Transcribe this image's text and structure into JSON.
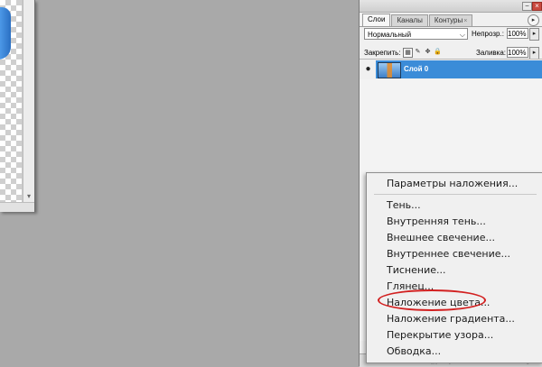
{
  "document": {
    "scroll_arrow": "▾"
  },
  "panel": {
    "tabs": [
      {
        "label": "Слои",
        "active": true
      },
      {
        "label": "Каналы",
        "active": false
      },
      {
        "label": "Контуры",
        "active": false
      }
    ],
    "tab_close_glyph": "×",
    "menu_glyph": "▸",
    "blend_mode": "Нормальный",
    "opacity_label": "Непрозр.:",
    "opacity_value": "100%",
    "lock_label": "Закрепить:",
    "fill_label": "Заливка:",
    "fill_value": "100%",
    "layers": [
      {
        "name": "Слой 0",
        "visible": true,
        "selected": true
      }
    ],
    "eye_glyph": "●",
    "window_buttons": {
      "minimize": "−",
      "close": "×"
    }
  },
  "context_menu": {
    "items": [
      "Параметры наложения...",
      "Тень...",
      "Внутренняя тень...",
      "Внешнее свечение...",
      "Внутреннее свечение...",
      "Тиснение...",
      "Глянец...",
      "Наложение цвета...",
      "Наложение градиента...",
      "Перекрытие узора...",
      "Обводка..."
    ],
    "highlighted_item": "Наложение цвета..."
  },
  "colors": {
    "workspace": "#a9a9a9",
    "selection": "#3b8cd8",
    "highlight_ellipse": "#d22020"
  }
}
